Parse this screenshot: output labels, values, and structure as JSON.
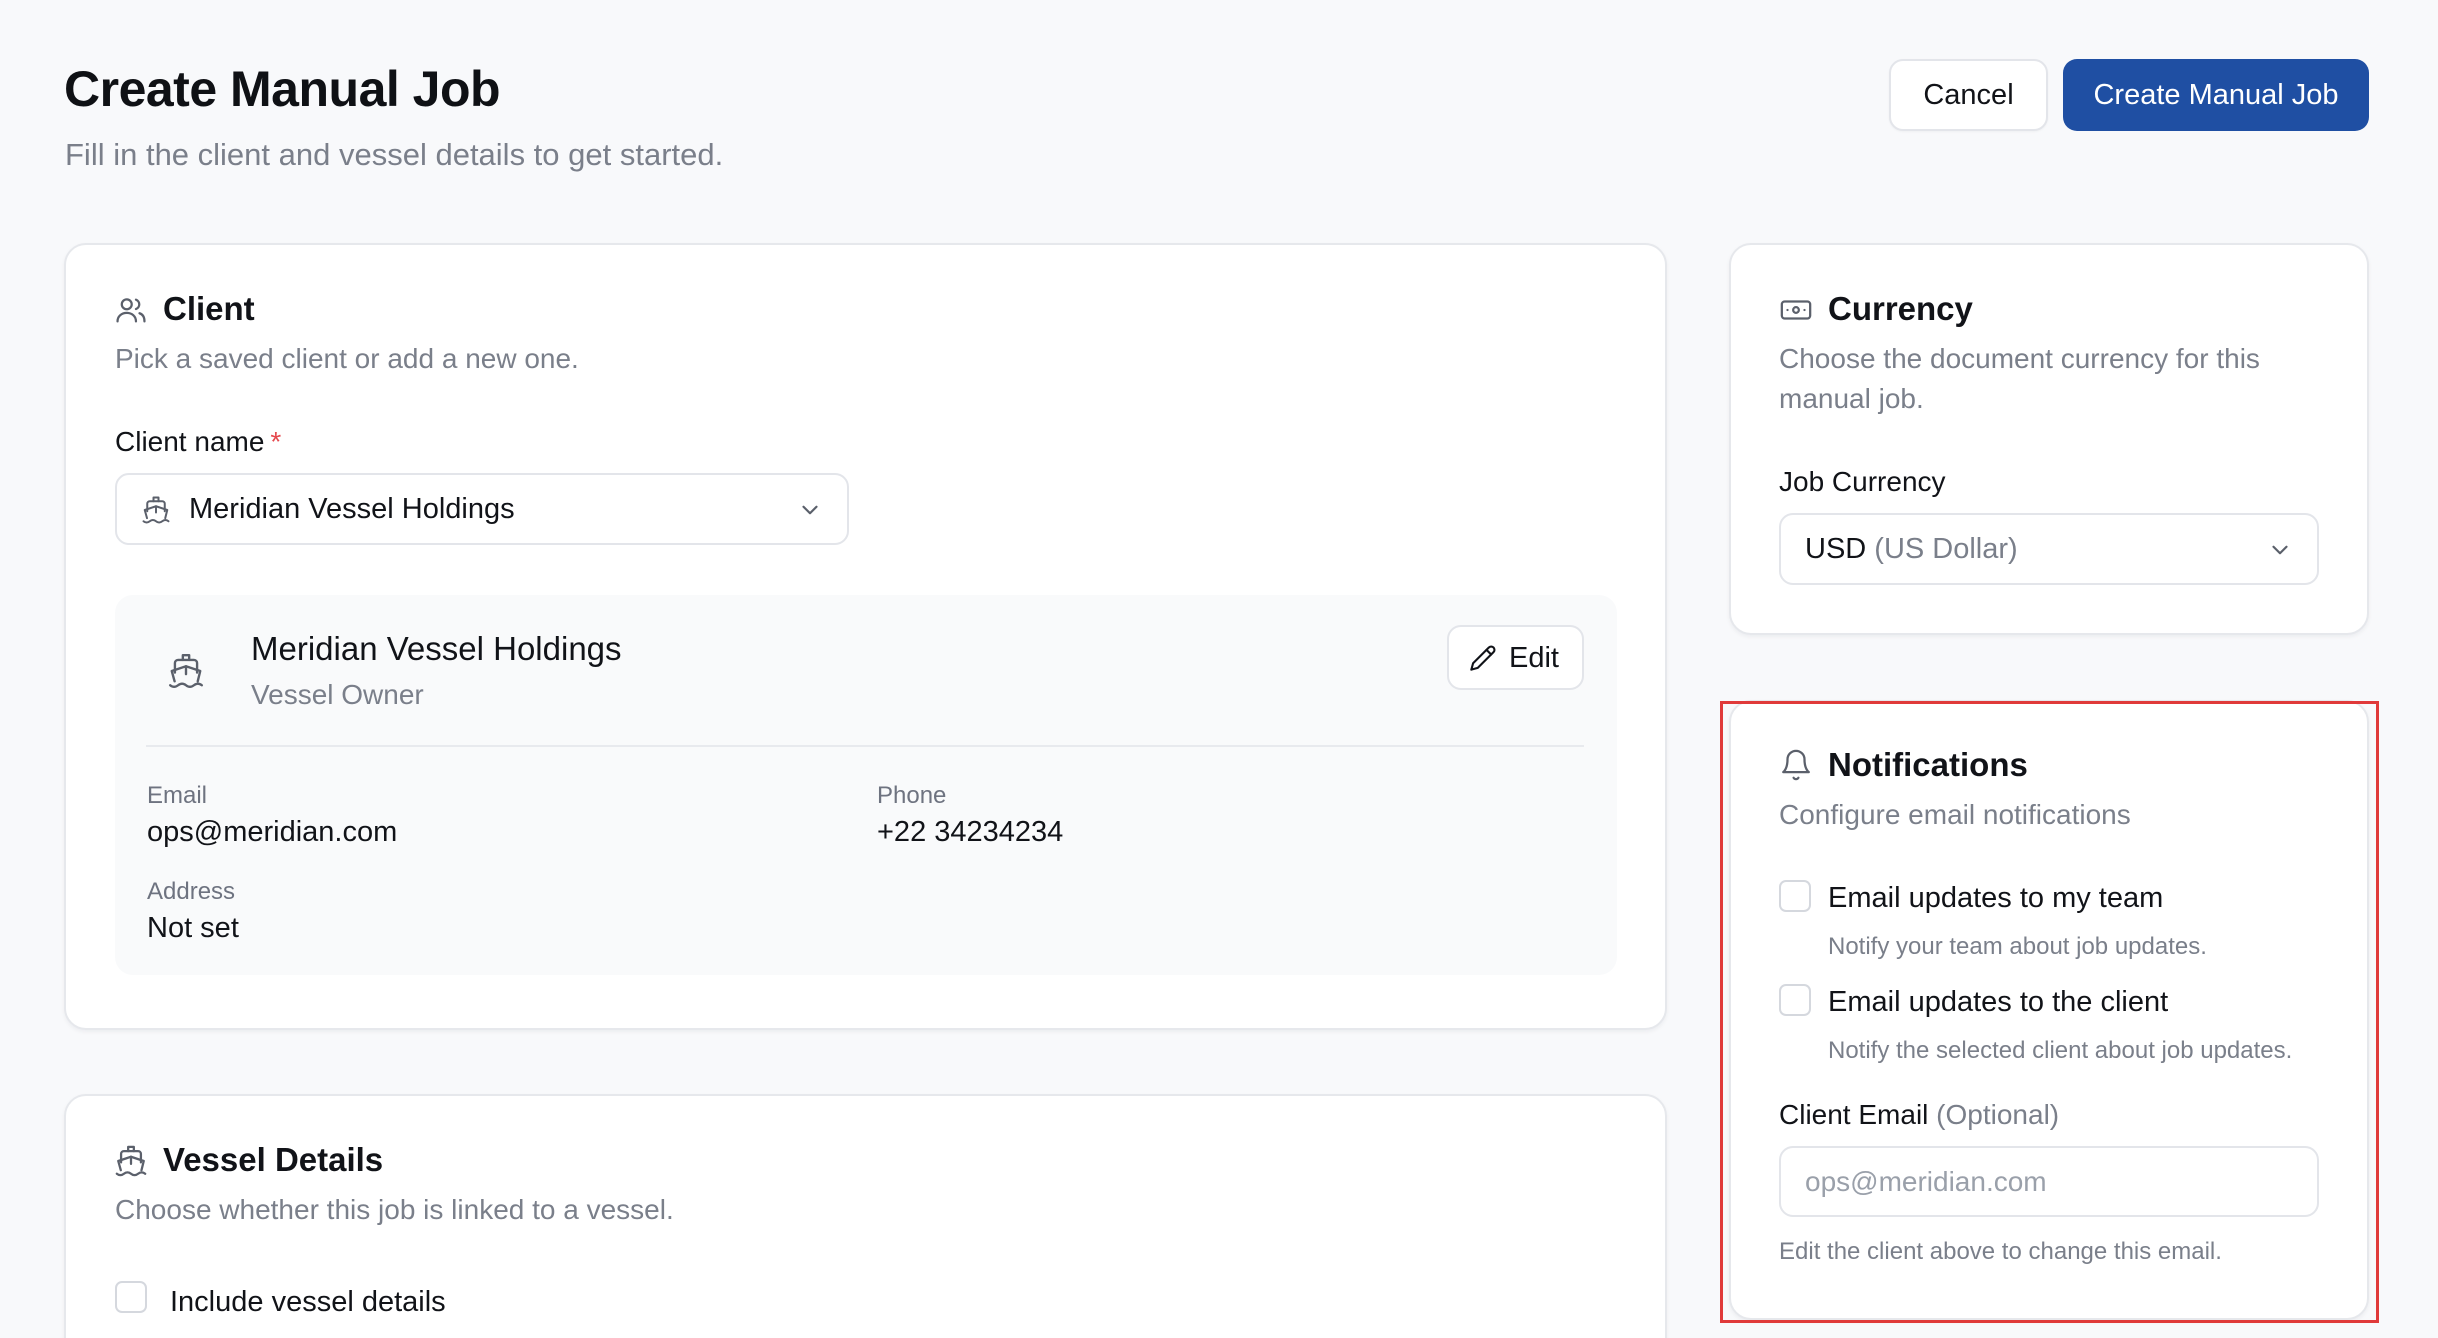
{
  "header": {
    "title": "Create Manual Job",
    "subtitle": "Fill in the client and vessel details to get started.",
    "cancel_label": "Cancel",
    "create_label": "Create Manual Job"
  },
  "client_card": {
    "title": "Client",
    "description": "Pick a saved client or add a new one.",
    "field_label": "Client name",
    "required_mark": "*",
    "selected_client": "Meridian Vessel Holdings",
    "details": {
      "name": "Meridian Vessel Holdings",
      "role": "Vessel Owner",
      "edit_label": "Edit",
      "email_label": "Email",
      "email_value": "ops@meridian.com",
      "phone_label": "Phone",
      "phone_value": "+22 34234234",
      "address_label": "Address",
      "address_value": "Not set"
    }
  },
  "vessel_card": {
    "title": "Vessel Details",
    "description": "Choose whether this job is linked to a vessel.",
    "include_label": "Include vessel details",
    "include_checked": false
  },
  "currency_card": {
    "title": "Currency",
    "description": "Choose the document currency for this manual job.",
    "field_label": "Job Currency",
    "selected_code": "USD",
    "selected_name": "(US Dollar)"
  },
  "notifications_card": {
    "title": "Notifications",
    "description": "Configure email notifications",
    "team_label": "Email updates to my team",
    "team_desc": "Notify your team about job updates.",
    "team_checked": false,
    "client_label": "Email updates to the client",
    "client_desc": "Notify the selected client about job updates.",
    "client_checked": false,
    "client_email_label": "Client Email",
    "client_email_optional": "(Optional)",
    "client_email_placeholder": "ops@meridian.com",
    "client_email_hint": "Edit the client above to change this email."
  },
  "colors": {
    "primary": "#1f4fa3",
    "required": "#e5484d",
    "highlight": "#e03a3a",
    "background": "#f8f9fb"
  },
  "icons": {
    "client": "users-icon",
    "ship": "ship-icon",
    "currency": "banknote-icon",
    "notifications": "bell-icon",
    "edit": "pencil-icon",
    "dropdown": "chevron-down-icon"
  }
}
